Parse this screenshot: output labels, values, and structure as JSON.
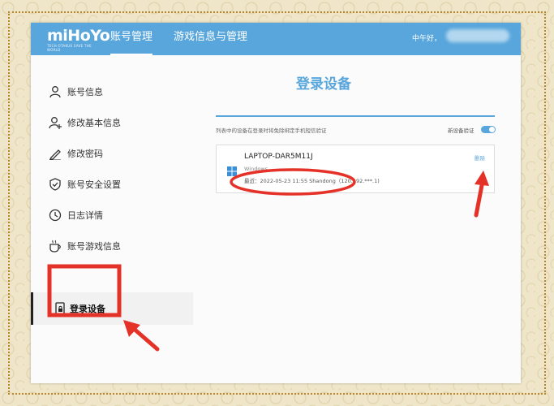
{
  "header": {
    "logo_text": "miHoYo",
    "logo_tagline": "TECH OTAKUS SAVE THE WORLD",
    "nav": [
      {
        "label": "账号管理",
        "active": true
      },
      {
        "label": "游戏信息与管理",
        "active": false
      }
    ],
    "greeting": "中午好，"
  },
  "sidebar": {
    "items": [
      {
        "label": "账号信息",
        "icon": "user-icon"
      },
      {
        "label": "修改基本信息",
        "icon": "user-edit-icon"
      },
      {
        "label": "修改密码",
        "icon": "pencil-icon"
      },
      {
        "label": "账号安全设置",
        "icon": "shield-check-icon"
      },
      {
        "label": "日志详情",
        "icon": "clock-icon"
      },
      {
        "label": "账号游戏信息",
        "icon": "cup-icon"
      },
      {
        "label": "登录设备",
        "icon": "device-lock-icon",
        "active": true
      }
    ]
  },
  "main": {
    "title": "登录设备",
    "hint": "列表中的设备在登录时将免除绑定手机短信验证",
    "toggle_label": "新设备验证",
    "toggle_on": true,
    "devices": [
      {
        "name": "LAPTOP-DAR5M11J",
        "os": "Windows",
        "last_login": "最近：2022-05-23 11:55   Shandong（120.192.***.1)",
        "delete_label": "删除"
      }
    ]
  },
  "colors": {
    "brand": "#58a6dc",
    "annotation_red": "#e53228"
  }
}
